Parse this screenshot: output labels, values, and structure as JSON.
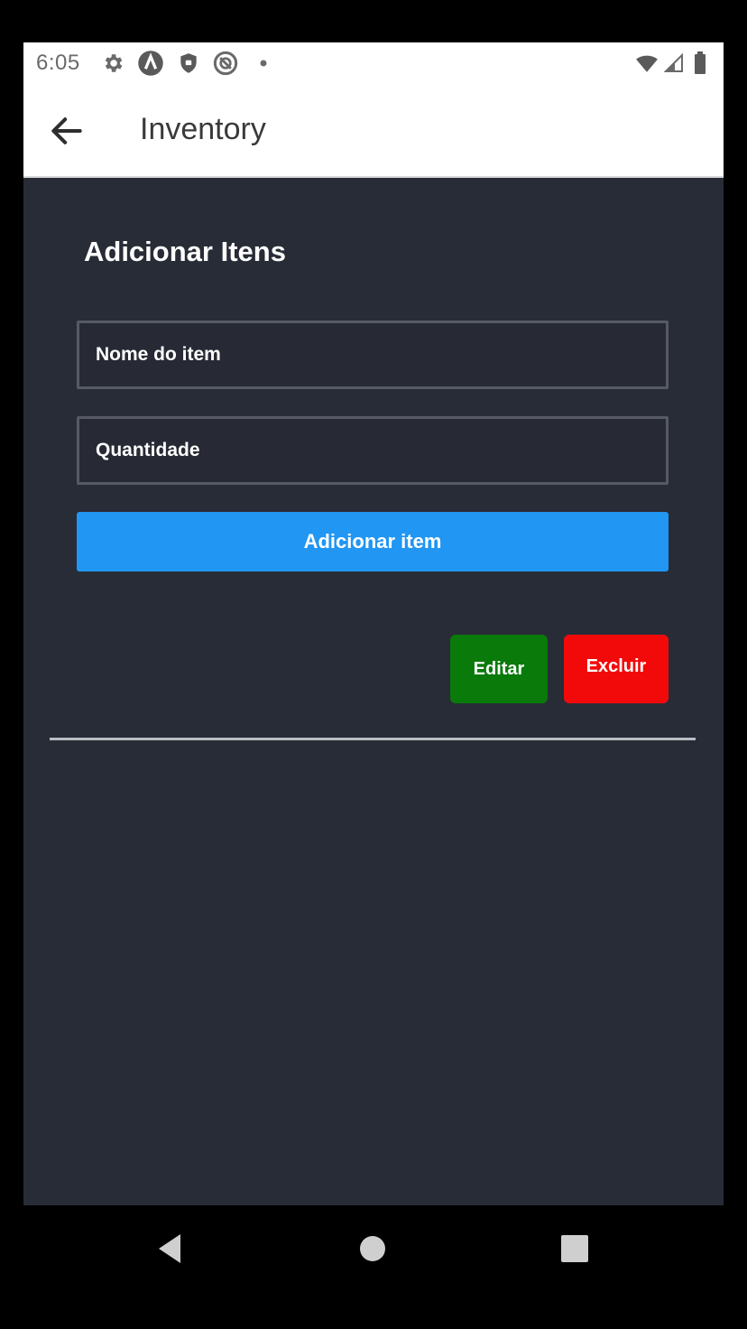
{
  "status_bar": {
    "time": "6:05",
    "left_icons": [
      "settings-icon",
      "app-a-icon",
      "shield-icon",
      "sync-icon",
      "dot-icon"
    ],
    "right_icons": [
      "wifi-icon",
      "signal-icon",
      "battery-icon"
    ]
  },
  "app_bar": {
    "title": "Inventory",
    "back_icon": "arrow-left-icon"
  },
  "form": {
    "heading": "Adicionar Itens",
    "name_placeholder": "Nome do item",
    "name_value": "",
    "quantity_placeholder": "Quantidade",
    "quantity_value": "",
    "add_label": "Adicionar item"
  },
  "item_actions": {
    "edit_label": "Editar",
    "delete_label": "Excluir"
  },
  "nav_bar": {
    "buttons": [
      "back-triangle-icon",
      "home-circle-icon",
      "recents-square-icon"
    ]
  },
  "colors": {
    "background": "#282c37",
    "primary": "#2196f3",
    "edit": "#0a7a0a",
    "delete": "#f20a0a"
  }
}
